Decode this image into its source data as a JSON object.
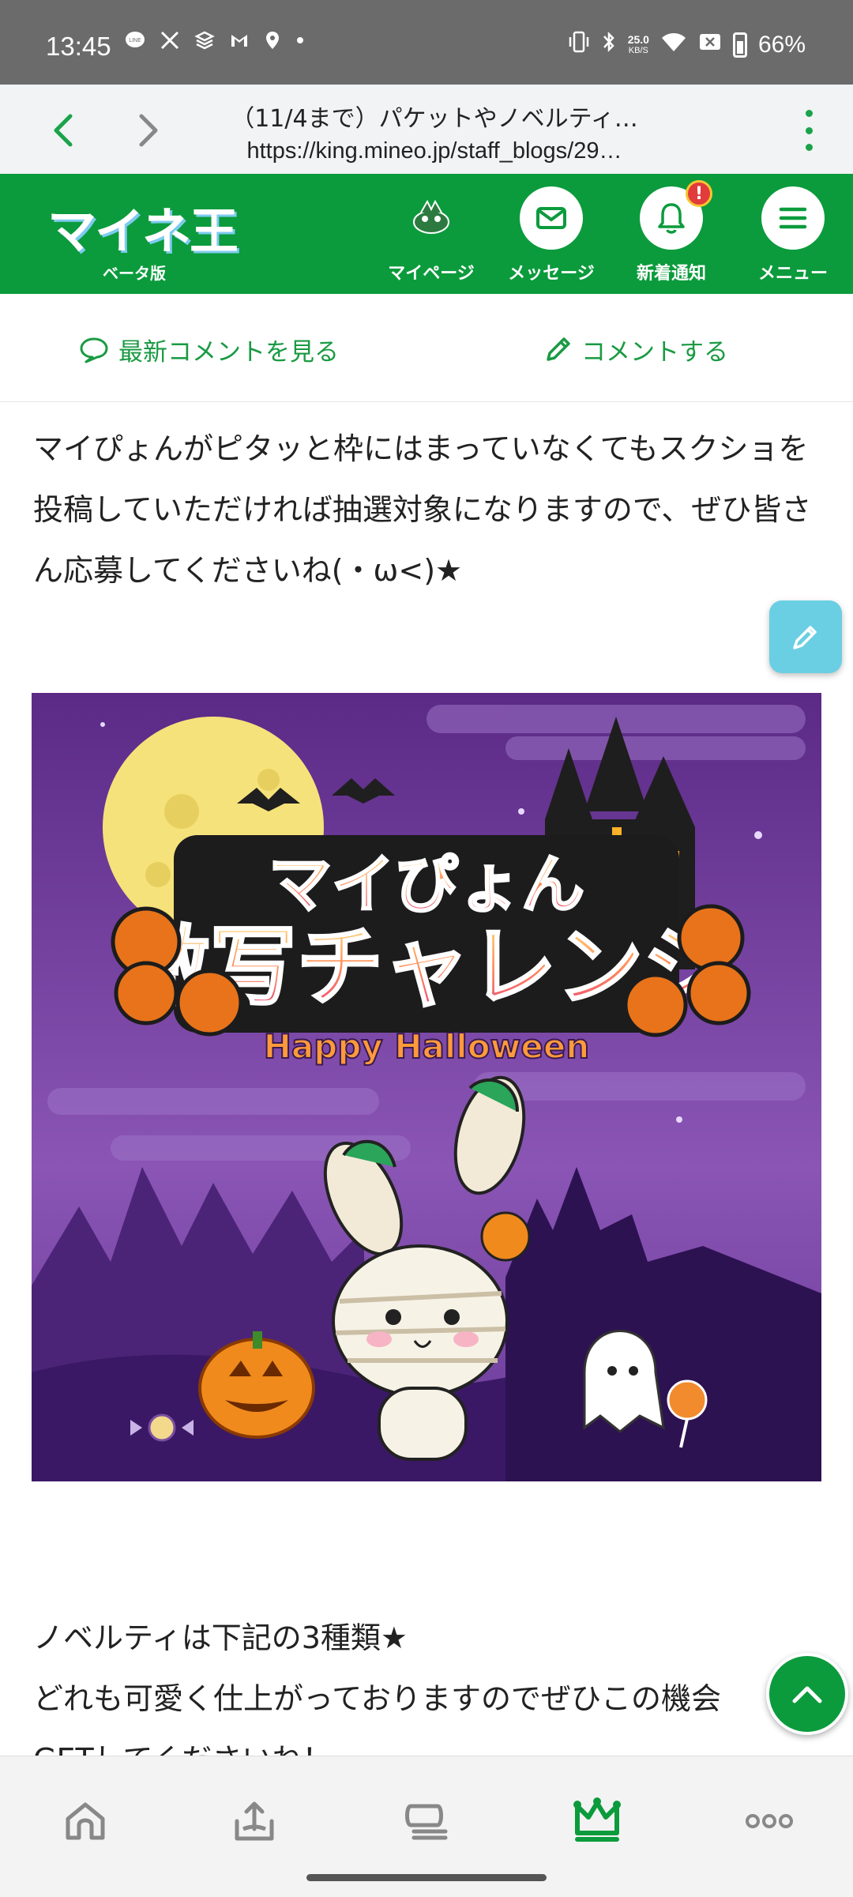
{
  "status_bar": {
    "time": "13:45",
    "net_speed_top": "25.0",
    "net_speed_unit": "KB/S",
    "battery": "66%",
    "icons": [
      "line-icon",
      "x-icon",
      "stack-icon",
      "gmail-icon",
      "location-icon",
      "dot-icon",
      "vibrate-icon",
      "bluetooth-icon",
      "wifi-icon",
      "sim-icon",
      "battery-icon"
    ]
  },
  "browser": {
    "page_title": "（11/4まで）パケットやノベルティ…",
    "url": "https://king.mineo.jp/staff_blogs/29…"
  },
  "header": {
    "logo": "マイネ王",
    "logo_sub": "ベータ版",
    "items": [
      {
        "label": "マイページ",
        "icon": "avatar-icon"
      },
      {
        "label": "メッセージ",
        "icon": "mail-icon"
      },
      {
        "label": "新着通知",
        "icon": "bell-icon",
        "badge": "!"
      },
      {
        "label": "メニュー",
        "icon": "hamburger-icon"
      }
    ],
    "colors": {
      "brand": "#0b9b3c",
      "badge": "#e23b3b"
    }
  },
  "comment_bar": {
    "latest": "最新コメントを見る",
    "write": "コメントする"
  },
  "article": {
    "paragraph1": "マイぴょんがピタッと枠にはまっていなくてもスクショを投稿していただければ抽選対象になりますので、ぜひ皆さん応募してくださいね(・ω<)★",
    "banner": {
      "title_top": "マイぴょん",
      "title_main": "激写チャレンジ",
      "subtitle": "Happy Halloween"
    },
    "paragraph2_line1": "ノベルティは下記の3種類★",
    "paragraph2_line2": "どれも可愛く仕上がっておりますのでぜひこの機会",
    "paragraph2_line3": "GETしてくださいね！"
  },
  "bottom_nav": [
    "home-icon",
    "upload-icon",
    "board-icon",
    "crown-icon",
    "more-icon"
  ]
}
